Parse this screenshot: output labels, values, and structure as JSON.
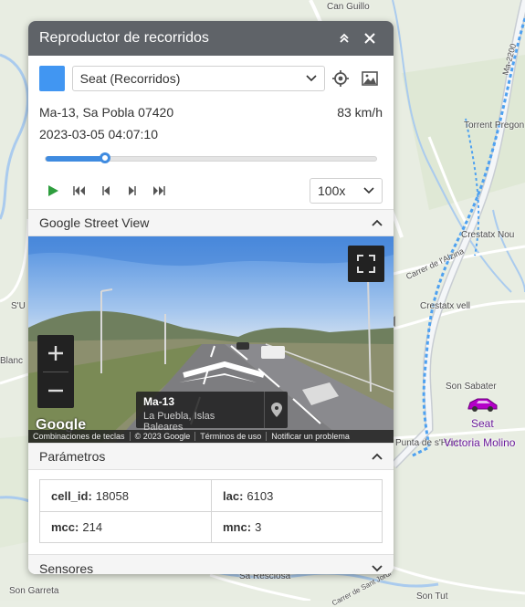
{
  "map": {
    "labels": [
      "Can Guillo",
      "Torrent Pregon",
      "Crestatx Nou",
      "Carrer de l'Alzina",
      "Crestatx vell",
      "Son Sabater",
      "Punta de s'Hort",
      "Sa Resclosa",
      "Son Garreta",
      "Son Tut",
      "Ma-2200",
      "Blanc",
      "S'U",
      "Carrer de Sant Jordi"
    ],
    "car_label": "Seat",
    "town_label": "Victoria Molino"
  },
  "panel": {
    "title": "Reproductor de recorridos",
    "vehicle": {
      "color": "#4196f2",
      "selected": "Seat (Recorridos)"
    },
    "address": "Ma-13, Sa Pobla 07420",
    "speed": "83 km/h",
    "datetime": "2023-03-05 04:07:10",
    "progress": 0.18,
    "playback_speed": "100x",
    "accent_color": "#3f8be0",
    "play_color": "#2e9e3e"
  },
  "street_view": {
    "section_title": "Google Street View",
    "street": "Ma-13",
    "town": "La Puebla, Islas Baleares",
    "logo": "Google",
    "footer": [
      "Combinaciones de teclas",
      "© 2023 Google",
      "Términos de uso",
      "Notificar un problema"
    ]
  },
  "parameters": {
    "section_title": "Parámetros",
    "items": [
      {
        "key": "cell_id:",
        "value": "18058"
      },
      {
        "key": "lac:",
        "value": "6103"
      },
      {
        "key": "mcc:",
        "value": "214"
      },
      {
        "key": "mnc:",
        "value": "3"
      }
    ]
  },
  "sensors": {
    "section_title": "Sensores"
  }
}
